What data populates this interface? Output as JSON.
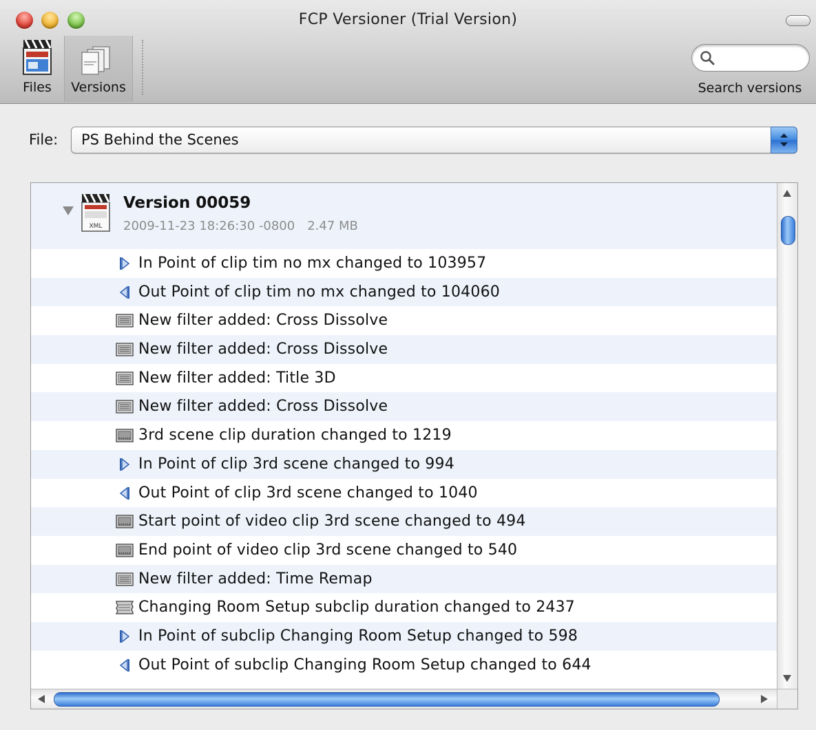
{
  "window": {
    "title": "FCP Versioner (Trial Version)"
  },
  "toolbar": {
    "files_label": "Files",
    "versions_label": "Versions",
    "search_placeholder": "",
    "search_label": "Search versions"
  },
  "file_selector": {
    "label": "File:",
    "value": "PS Behind the Scenes"
  },
  "version": {
    "name": "Version 00059",
    "date": "2009-11-23 18:26:30 -0800",
    "size": "2.47 MB",
    "icon_label": "XML"
  },
  "changes": [
    {
      "icon": "in-point",
      "text": "In Point of clip tim no mx changed to 103957"
    },
    {
      "icon": "out-point",
      "text": "Out Point of clip tim no mx changed to 104060"
    },
    {
      "icon": "filter",
      "text": "New filter added: Cross Dissolve"
    },
    {
      "icon": "filter",
      "text": "New filter added: Cross Dissolve"
    },
    {
      "icon": "filter",
      "text": "New filter added: Title 3D"
    },
    {
      "icon": "filter",
      "text": "New filter added: Cross Dissolve"
    },
    {
      "icon": "clip",
      "text": "3rd scene clip duration changed to 1219"
    },
    {
      "icon": "in-point",
      "text": "In Point of clip 3rd scene changed to 994"
    },
    {
      "icon": "out-point",
      "text": "Out Point of clip 3rd scene changed to 1040"
    },
    {
      "icon": "clip",
      "text": "Start point of video clip 3rd scene changed to 494"
    },
    {
      "icon": "clip",
      "text": "End point of video clip 3rd scene changed to 540"
    },
    {
      "icon": "filter",
      "text": "New filter added: Time Remap"
    },
    {
      "icon": "subclip",
      "text": "Changing Room Setup subclip duration changed to 2437"
    },
    {
      "icon": "in-point",
      "text": "In Point of subclip Changing Room Setup changed to 598"
    },
    {
      "icon": "out-point",
      "text": "Out Point of subclip Changing Room Setup changed to 644"
    }
  ]
}
